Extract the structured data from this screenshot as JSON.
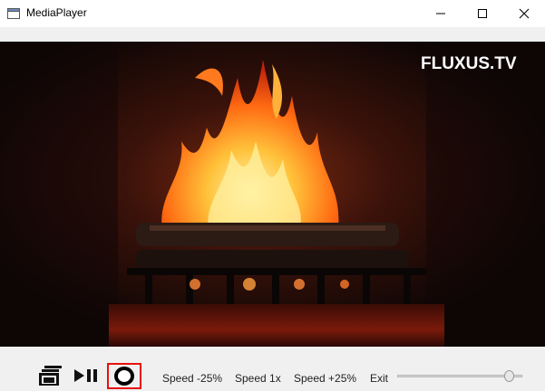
{
  "window": {
    "title": "MediaPlayer",
    "icon": "window-app-icon"
  },
  "window_controls": {
    "minimize": "minimize-icon",
    "maximize": "maximize-icon",
    "close": "close-icon"
  },
  "video": {
    "watermark": "FLUXUS.TV",
    "scene": "fireplace-fire"
  },
  "controls": {
    "fullscreen_icon": "fullscreen-icon",
    "playpause_icon": "play-pause-icon",
    "stop_icon": "stop-icon",
    "speed_down_label": "Speed -25%",
    "speed_normal_label": "Speed 1x",
    "speed_up_label": "Speed +25%",
    "exit_label": "Exit",
    "volume_level": 0.93,
    "highlight_color": "#e81010"
  }
}
